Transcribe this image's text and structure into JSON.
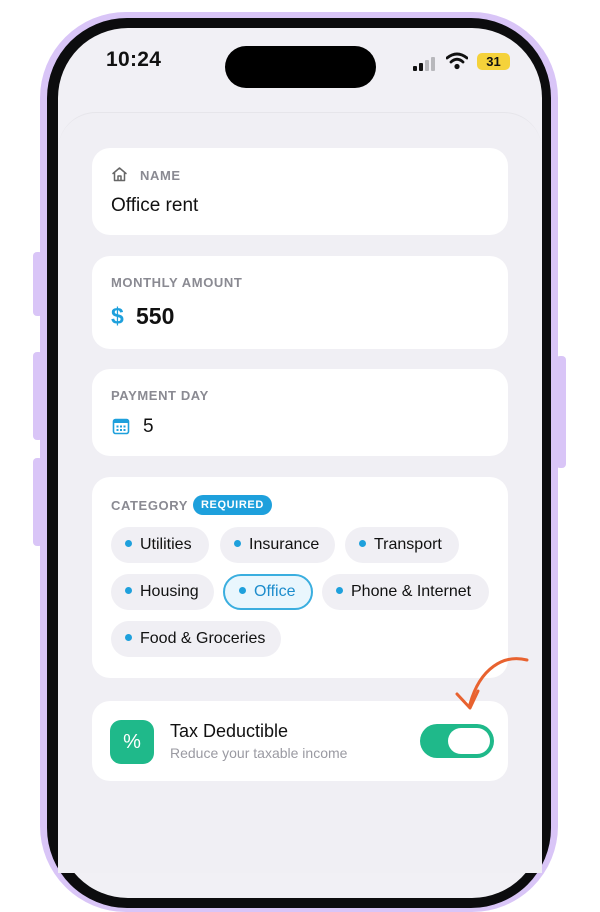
{
  "status_bar": {
    "time": "10:24",
    "battery": "31"
  },
  "name_field": {
    "label": "NAME",
    "value": "Office rent",
    "icon": "home-icon"
  },
  "amount_field": {
    "label": "MONTHLY AMOUNT",
    "currency": "$",
    "value": "550"
  },
  "payment_day_field": {
    "label": "PAYMENT DAY",
    "value": "5",
    "icon": "calendar-icon"
  },
  "category": {
    "label": "CATEGORY",
    "badge": "REQUIRED",
    "chips": [
      {
        "label": "Utilities",
        "selected": false
      },
      {
        "label": "Insurance",
        "selected": false
      },
      {
        "label": "Transport",
        "selected": false
      },
      {
        "label": "Housing",
        "selected": false
      },
      {
        "label": "Office",
        "selected": true
      },
      {
        "label": "Phone & Internet",
        "selected": false
      },
      {
        "label": "Food & Groceries",
        "selected": false
      }
    ]
  },
  "tax": {
    "icon_text": "%",
    "title": "Tax Deductible",
    "subtitle": "Reduce your taxable income",
    "enabled": true
  },
  "colors": {
    "accent": "#1ea0dc",
    "green": "#1fb98a",
    "frame": "#d9c5f7",
    "arrow": "#e8622f"
  }
}
